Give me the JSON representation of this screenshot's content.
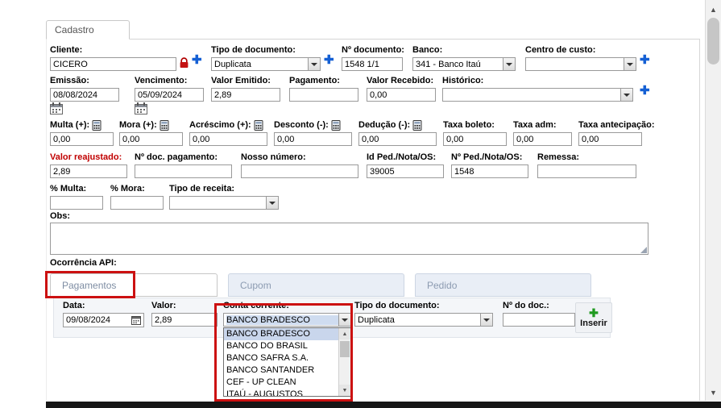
{
  "tab": {
    "cadastro": "Cadastro"
  },
  "fields": {
    "cliente": {
      "label": "Cliente:",
      "value": "CICERO"
    },
    "tipo_documento": {
      "label": "Tipo de documento:",
      "value": "Duplicata"
    },
    "n_documento": {
      "label": "Nº documento:",
      "value": "1548 1/1"
    },
    "banco": {
      "label": "Banco:",
      "value": "341 - Banco Itaú"
    },
    "centro_custo": {
      "label": "Centro de custo:",
      "value": ""
    },
    "emissao": {
      "label": "Emissão:",
      "value": "08/08/2024"
    },
    "vencimento": {
      "label": "Vencimento:",
      "value": "05/09/2024"
    },
    "valor_emitido": {
      "label": "Valor Emitido:",
      "value": "2,89"
    },
    "pagamento": {
      "label": "Pagamento:",
      "value": ""
    },
    "valor_recebido": {
      "label": "Valor Recebido:",
      "value": "0,00"
    },
    "historico": {
      "label": "Histórico:",
      "value": ""
    },
    "multa": {
      "label": "Multa (+):",
      "value": "0,00"
    },
    "mora": {
      "label": "Mora (+):",
      "value": "0,00"
    },
    "acrescimo": {
      "label": "Acréscimo (+):",
      "value": "0,00"
    },
    "desconto": {
      "label": "Desconto (-):",
      "value": "0,00"
    },
    "deducao": {
      "label": "Dedução (-):",
      "value": "0,00"
    },
    "taxa_boleto": {
      "label": "Taxa boleto:",
      "value": "0,00"
    },
    "taxa_adm": {
      "label": "Taxa adm:",
      "value": "0,00"
    },
    "taxa_antecipacao": {
      "label": "Taxa antecipação:",
      "value": "0,00"
    },
    "valor_reajustado": {
      "label": "Valor reajustado:",
      "value": "2,89"
    },
    "n_doc_pagamento": {
      "label": "Nº doc. pagamento:",
      "value": ""
    },
    "nosso_numero": {
      "label": "Nosso número:",
      "value": ""
    },
    "id_ped": {
      "label": "Id Ped./Nota/OS:",
      "value": "39005"
    },
    "n_ped": {
      "label": "Nº Ped./Nota/OS:",
      "value": "1548"
    },
    "remessa": {
      "label": "Remessa:",
      "value": ""
    },
    "pct_multa": {
      "label": "% Multa:",
      "value": ""
    },
    "pct_mora": {
      "label": "% Mora:",
      "value": ""
    },
    "tipo_receita": {
      "label": "Tipo de receita:",
      "value": ""
    },
    "obs": {
      "label": "Obs:",
      "value": ""
    },
    "ocorrencia_api": {
      "label": "Ocorrência API:"
    }
  },
  "subtabs": {
    "pagamentos": "Pagamentos",
    "cupom": "Cupom",
    "pedido": "Pedido"
  },
  "pay": {
    "data": {
      "label": "Data:",
      "value": "09/08/2024"
    },
    "valor": {
      "label": "Valor:",
      "value": "2,89"
    },
    "conta": {
      "label": "Conta corrente:",
      "value": "BANCO BRADESCO"
    },
    "tipo": {
      "label": "Tipo do documento:",
      "value": "Duplicata"
    },
    "ndoc": {
      "label": "Nº do doc.:",
      "value": ""
    },
    "inserir": "Inserir",
    "options": [
      "BANCO BRADESCO",
      "BANCO DO BRASIL",
      "BANCO SAFRA S.A.",
      "BANCO SANTANDER",
      "CEF - UP CLEAN",
      "ITAÚ - AUGUSTOS"
    ],
    "selected_option": "BANCO BRADESCO"
  },
  "colors": {
    "annotation": "#cc1111",
    "add_icon_blue": "#1560d4",
    "insert_icon_green": "#1f9a1f",
    "reajustado_label": "#c00000",
    "selection_highlight": "#c9d6ec"
  }
}
